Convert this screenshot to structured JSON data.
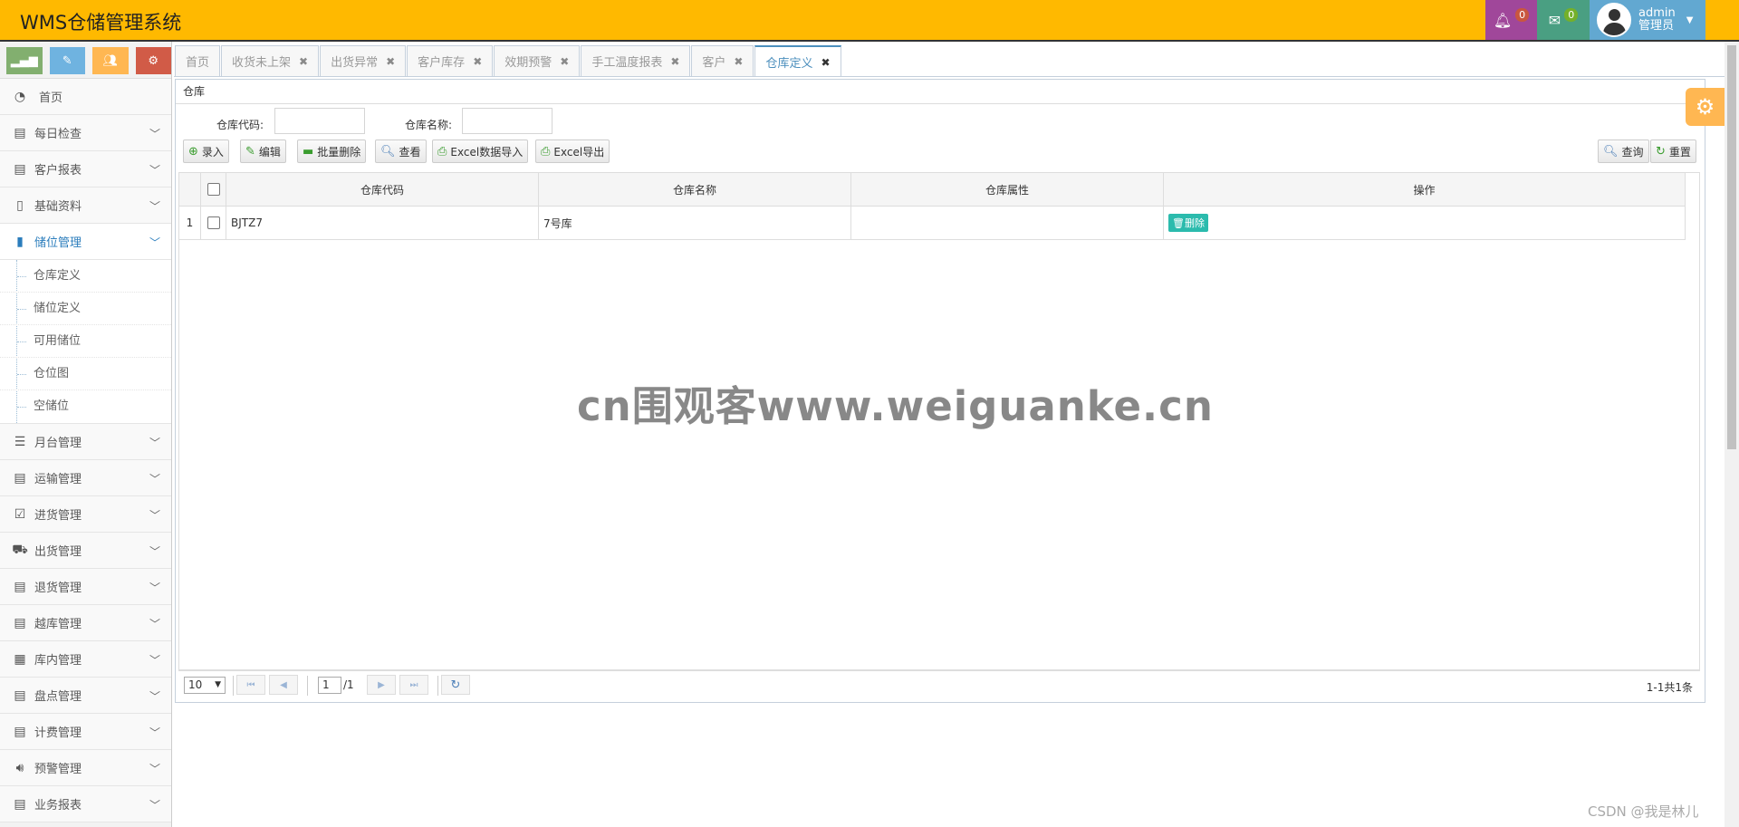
{
  "app": {
    "title": "WMS仓储管理系统"
  },
  "header": {
    "notifications_count": "0",
    "messages_count": "0",
    "user_name": "admin",
    "user_role": "管理员",
    "colors": {
      "bar": "#FFB900",
      "bell": "#A0479A",
      "mail": "#4A9F82",
      "user": "#62A8D1"
    }
  },
  "sidebar": {
    "home": "首页",
    "menu": [
      {
        "label": "每日检查",
        "icon": "list-icon"
      },
      {
        "label": "客户报表",
        "icon": "list-icon"
      },
      {
        "label": "基础资料",
        "icon": "file-icon"
      },
      {
        "label": "储位管理",
        "icon": "mobile-icon"
      },
      {
        "label": "月台管理",
        "icon": "list-icon"
      },
      {
        "label": "运输管理",
        "icon": "list-icon"
      },
      {
        "label": "进货管理",
        "icon": "check-square-icon"
      },
      {
        "label": "出货管理",
        "icon": "truck-icon"
      },
      {
        "label": "退货管理",
        "icon": "list-icon"
      },
      {
        "label": "越库管理",
        "icon": "list-icon"
      },
      {
        "label": "库内管理",
        "icon": "film-icon"
      },
      {
        "label": "盘点管理",
        "icon": "list-icon"
      },
      {
        "label": "计费管理",
        "icon": "list-icon"
      },
      {
        "label": "预警管理",
        "icon": "volume-icon"
      },
      {
        "label": "业务报表",
        "icon": "list-icon"
      }
    ],
    "submenu": [
      "仓库定义",
      "储位定义",
      "可用储位",
      "仓位图",
      "空储位"
    ]
  },
  "tabs": [
    {
      "label": "首页",
      "closable": false
    },
    {
      "label": "收货未上架",
      "closable": true
    },
    {
      "label": "出货异常",
      "closable": true
    },
    {
      "label": "客户库存",
      "closable": true
    },
    {
      "label": "效期预警",
      "closable": true
    },
    {
      "label": "手工温度报表",
      "closable": true
    },
    {
      "label": "客户",
      "closable": true
    },
    {
      "label": "仓库定义",
      "closable": true,
      "active": true
    }
  ],
  "panel": {
    "title": "仓库",
    "search": {
      "code_label": "仓库代码:",
      "name_label": "仓库名称:",
      "code_value": "",
      "name_value": ""
    },
    "toolbar": {
      "add": "录入",
      "edit": "编辑",
      "batch_delete": "批量删除",
      "view": "查看",
      "excel_import": "Excel数据导入",
      "excel_export": "Excel导出",
      "query": "查询",
      "reset": "重置"
    },
    "grid": {
      "columns": [
        "仓库代码",
        "仓库名称",
        "仓库属性",
        "操作"
      ],
      "rows": [
        {
          "index": "1",
          "code": "BJTZ7",
          "name": "7号库",
          "attr": "",
          "action": "删除"
        }
      ]
    },
    "pager": {
      "page_size": "10",
      "page": "1",
      "total_pages": "/1",
      "info": "1-1共1条"
    }
  },
  "watermark": "cn围观客www.weiguanke.cn",
  "corner_text": "CSDN @我是林儿"
}
